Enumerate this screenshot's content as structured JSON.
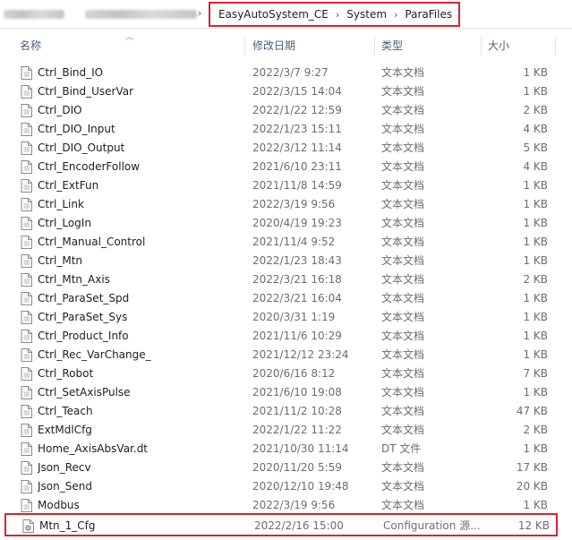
{
  "address": {
    "breadcrumbs": [
      "EasyAutoSystem_CE",
      "System",
      "ParaFiles"
    ]
  },
  "columns": {
    "name": "名称",
    "modified": "修改日期",
    "type": "类型",
    "size": "大小"
  },
  "icons": {
    "text_file": "text-file-icon",
    "config_file": "config-file-icon",
    "sort": "sort-up-icon"
  },
  "files": [
    {
      "name": "Ctrl_Bind_IO",
      "modified": "2022/3/7 9:27",
      "type": "文本文档",
      "size": "1 KB"
    },
    {
      "name": "Ctrl_Bind_UserVar",
      "modified": "2022/3/15 14:04",
      "type": "文本文档",
      "size": "1 KB"
    },
    {
      "name": "Ctrl_DIO",
      "modified": "2022/1/22 12:59",
      "type": "文本文档",
      "size": "2 KB"
    },
    {
      "name": "Ctrl_DIO_Input",
      "modified": "2022/1/23 15:11",
      "type": "文本文档",
      "size": "4 KB"
    },
    {
      "name": "Ctrl_DIO_Output",
      "modified": "2022/3/12 11:14",
      "type": "文本文档",
      "size": "5 KB"
    },
    {
      "name": "Ctrl_EncoderFollow",
      "modified": "2021/6/10 23:11",
      "type": "文本文档",
      "size": "4 KB"
    },
    {
      "name": "Ctrl_ExtFun",
      "modified": "2021/11/8 14:59",
      "type": "文本文档",
      "size": "1 KB"
    },
    {
      "name": "Ctrl_Link",
      "modified": "2022/3/19 9:56",
      "type": "文本文档",
      "size": "1 KB"
    },
    {
      "name": "Ctrl_LogIn",
      "modified": "2020/4/19 19:23",
      "type": "文本文档",
      "size": "1 KB"
    },
    {
      "name": "Ctrl_Manual_Control",
      "modified": "2021/11/4 9:52",
      "type": "文本文档",
      "size": "1 KB"
    },
    {
      "name": "Ctrl_Mtn",
      "modified": "2022/1/23 18:43",
      "type": "文本文档",
      "size": "1 KB"
    },
    {
      "name": "Ctrl_Mtn_Axis",
      "modified": "2022/3/21 16:18",
      "type": "文本文档",
      "size": "2 KB"
    },
    {
      "name": "Ctrl_ParaSet_Spd",
      "modified": "2022/3/21 16:04",
      "type": "文本文档",
      "size": "1 KB"
    },
    {
      "name": "Ctrl_ParaSet_Sys",
      "modified": "2020/3/31 1:19",
      "type": "文本文档",
      "size": "1 KB"
    },
    {
      "name": "Ctrl_Product_Info",
      "modified": "2021/11/6 10:29",
      "type": "文本文档",
      "size": "1 KB"
    },
    {
      "name": "Ctrl_Rec_VarChange_",
      "modified": "2021/12/12 23:24",
      "type": "文本文档",
      "size": "1 KB"
    },
    {
      "name": "Ctrl_Robot",
      "modified": "2020/6/16 8:12",
      "type": "文本文档",
      "size": "7 KB"
    },
    {
      "name": "Ctrl_SetAxisPulse",
      "modified": "2021/6/10 19:08",
      "type": "文本文档",
      "size": "1 KB"
    },
    {
      "name": "Ctrl_Teach",
      "modified": "2021/11/2 10:28",
      "type": "文本文档",
      "size": "47 KB"
    },
    {
      "name": "ExtMdlCfg",
      "modified": "2022/1/22 11:22",
      "type": "文本文档",
      "size": "2 KB"
    },
    {
      "name": "Home_AxisAbsVar.dt",
      "modified": "2021/10/30 11:14",
      "type": "DT 文件",
      "size": "1 KB"
    },
    {
      "name": "Json_Recv",
      "modified": "2020/11/20 5:59",
      "type": "文本文档",
      "size": "17 KB"
    },
    {
      "name": "Json_Send",
      "modified": "2020/12/10 19:48",
      "type": "文本文档",
      "size": "20 KB"
    },
    {
      "name": "Modbus",
      "modified": "2022/3/19 9:56",
      "type": "文本文档",
      "size": "1 KB"
    }
  ],
  "highlighted_file": {
    "name": "Mtn_1_Cfg",
    "modified": "2022/2/16 15:00",
    "type": "Configuration 源...",
    "size": "12 KB"
  },
  "colors": {
    "highlight_border": "#d9232e",
    "header_text": "#4c607a"
  }
}
